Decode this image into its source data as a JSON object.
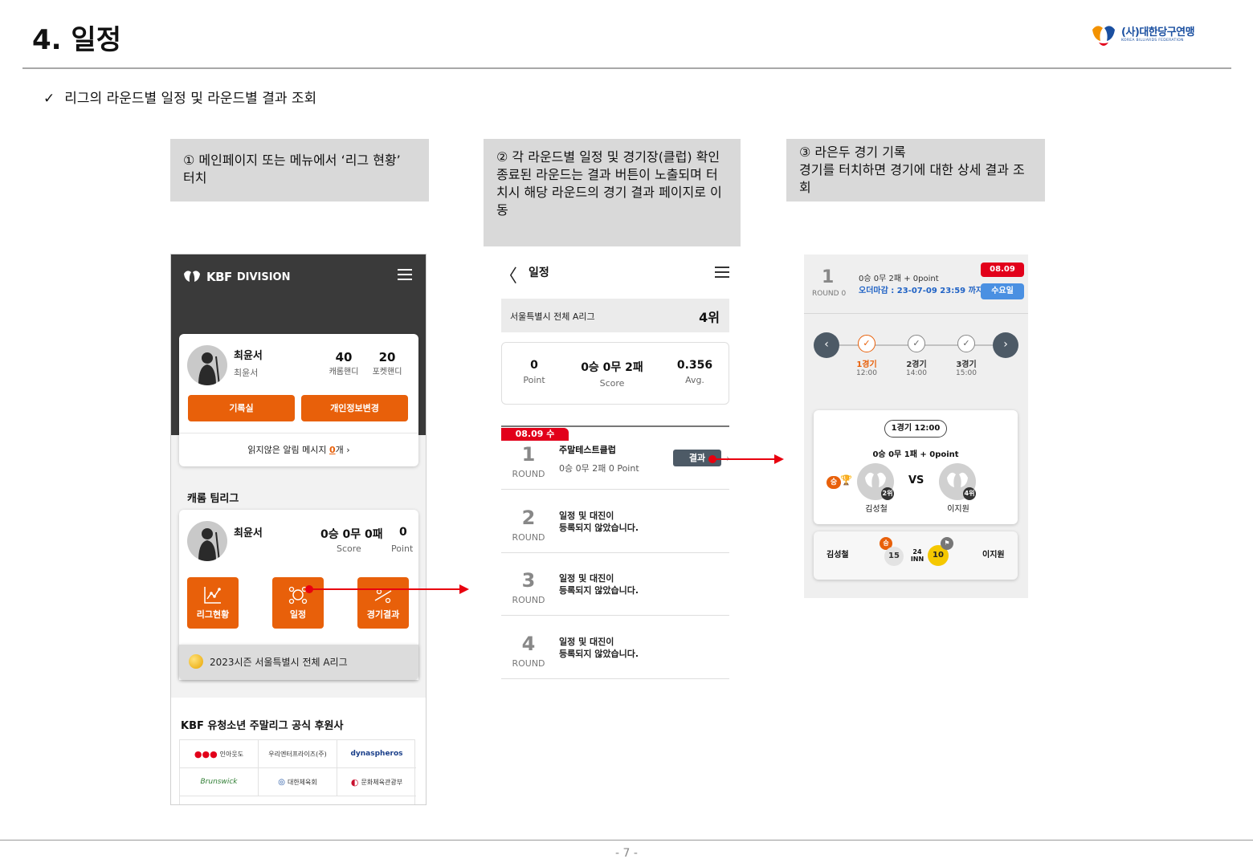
{
  "slide": {
    "title": "4. 일정",
    "bullet_mark": "✓",
    "bullet": "리그의 라운드별 일정 및 라운드별 결과 조회",
    "logo_ko": "(사)대한당구연맹",
    "logo_en": "KOREA BILLIARDS FEDERATION",
    "page_number": "- 7 -"
  },
  "callouts": {
    "c1": "① 메인페이지 또는 메뉴에서 ‘리그 현황’ 터치",
    "c2_line1": "② 각 라운드별 일정 및 경기장(클럽) 확인",
    "c2_line2": "종료된 라운드는 결과 버튼이 노출되며 터치시 해당 라운드의 경기 결과 페이지로 이동",
    "c3_line1": "③ 라은두 경기 기록",
    "c3_line2": "경기를 터치하면 경기에 대한 상세 결과 조회"
  },
  "phone1": {
    "brand_logo": "KBF",
    "brand": "DIVISION",
    "user_name": "최윤서",
    "user_sub": "최윤서",
    "carom_handi": "40",
    "carom_handi_label": "캐롬핸디",
    "pocket_handi": "20",
    "pocket_handi_label": "포켓핸디",
    "btn_record": "기록실",
    "btn_profile": "개인정보변경",
    "alert_pre": "읽지않은 알림 메시지 ",
    "alert_count": "0",
    "alert_post": "개 ›",
    "section": "캐롬 팀리그",
    "league_name": "최윤서",
    "league_record": "0승 0무 0패",
    "league_points": "0",
    "score_label": "Score",
    "point_label": "Point",
    "tile_status": "리그현황",
    "tile_schedule": "일정",
    "tile_results": "경기결과",
    "season": "2023시즌 서울특별시 전체 A리그",
    "sponsor_title": "KBF 유청소년 주말리그 공식 후원사",
    "sponsors": [
      "인아웃도",
      "우리엔터프라이즈(주)",
      "dynaspheros",
      "Brunswick",
      "대한체육회",
      "문화체육관광부"
    ]
  },
  "phone2": {
    "back": "〈",
    "title": "일정",
    "league": "서울특별시 전체 A리그",
    "rank": "4위",
    "point_val": "0",
    "point_lbl": "Point",
    "score_val": "0승 0무 2패",
    "score_lbl": "Score",
    "avg_val": "0.356",
    "avg_lbl": "Avg.",
    "date_badge": "08.09 수",
    "round_label": "ROUND",
    "r1_num": "1",
    "r1_club": "주말테스트클럽",
    "r1_record": "0승 0무 2패 0 Point",
    "result_btn": "결과",
    "r2_num": "2",
    "r3_num": "3",
    "r4_num": "4",
    "not_set_l1": "일정 및 대진이",
    "not_set_l2": "등록되지 않았습니다."
  },
  "phone3": {
    "round_num": "1",
    "round_label": "ROUND 0",
    "record": "0승 0무 2패 + 0point",
    "deadline": "오더마감 : 23-07-09 23:59 까지",
    "date": "08.09",
    "day": "수요일",
    "games": [
      {
        "label": "1경기",
        "time": "12:00"
      },
      {
        "label": "2경기",
        "time": "14:00"
      },
      {
        "label": "3경기",
        "time": "15:00"
      }
    ],
    "pill": "1경기 12:00",
    "match_record": "0승 0무 1패 + 0point",
    "vs": "VS",
    "win": "승",
    "p1_rank": "2위",
    "p2_rank": "4위",
    "p1_name": "김성철",
    "p2_name": "이지원",
    "p1_score": "15",
    "inn_num": "24",
    "inn_lbl": "INN",
    "p2_score": "10"
  },
  "colors": {
    "accent": "#e8600a",
    "red": "#e2001a",
    "arrow": "#e8000f",
    "blue": "#4a90e2"
  }
}
